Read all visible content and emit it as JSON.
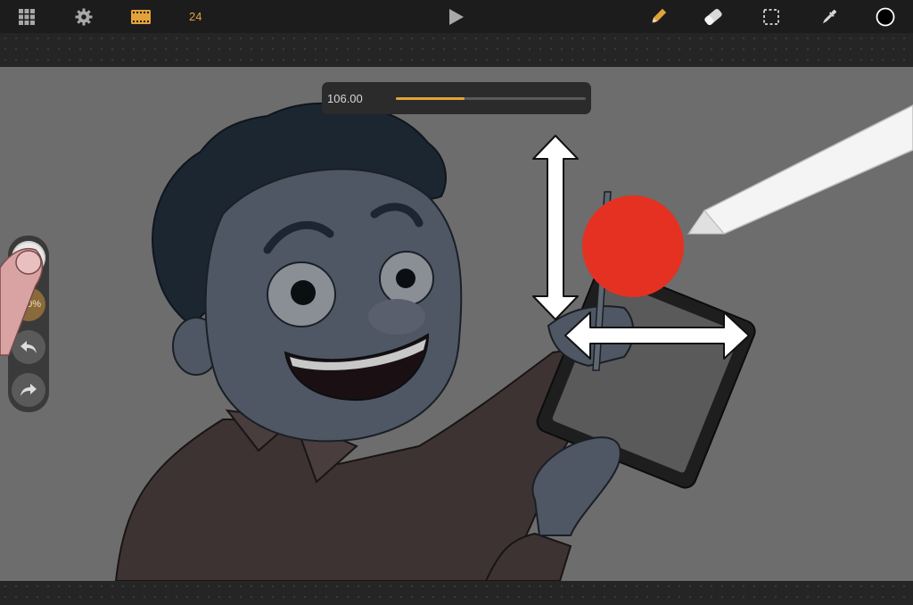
{
  "toolbar": {
    "left_icons": [
      "grid-icon",
      "gear-icon",
      "film-icon"
    ],
    "frame_count": "24",
    "play_icon": "play-icon",
    "right_icons": [
      "pencil-icon",
      "eraser-icon",
      "selection-icon",
      "eyedropper-icon",
      "color-swatch"
    ],
    "accent_color": "#e2a23b",
    "current_color": "#000000"
  },
  "slider": {
    "value_label": "106.00",
    "fill_fraction": 0.36
  },
  "side_panel": {
    "opacity_label": "100%",
    "undo_icon": "undo-icon",
    "redo_icon": "redo-icon"
  },
  "touch_indicator": {
    "color": "#e53121"
  }
}
